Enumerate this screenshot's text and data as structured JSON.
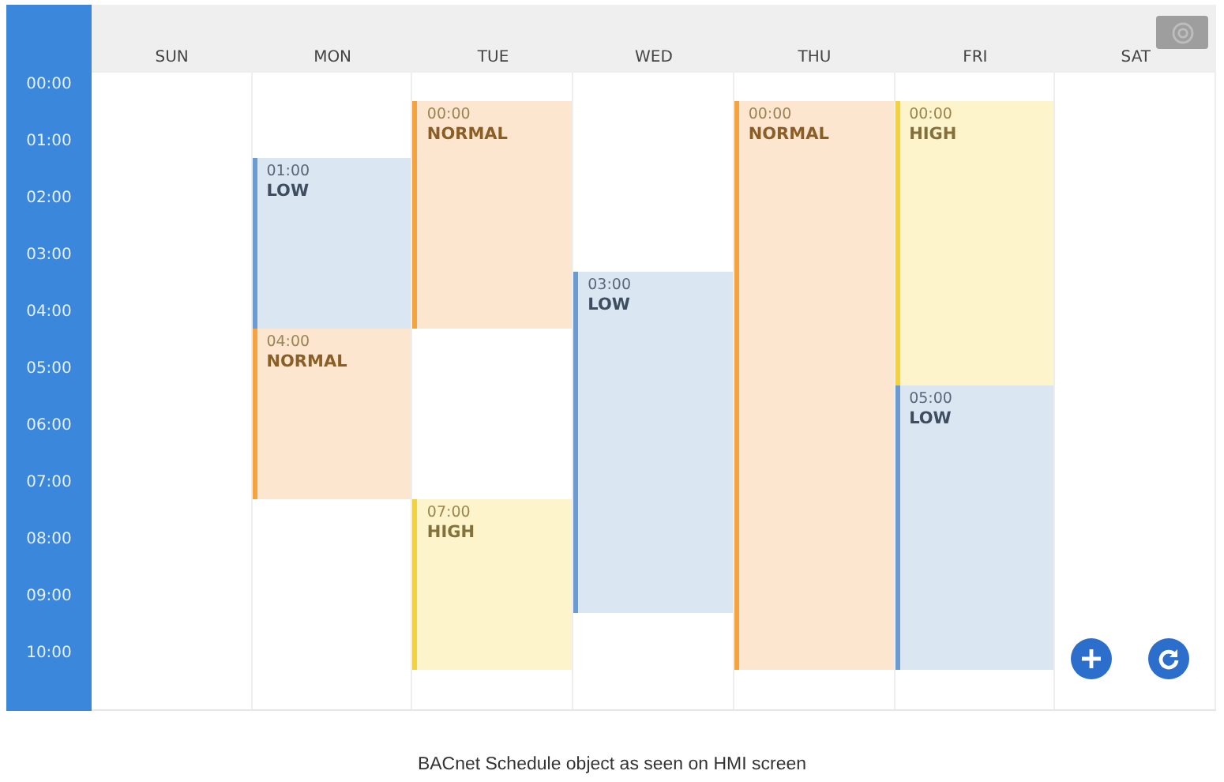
{
  "times": [
    "00:00",
    "01:00",
    "02:00",
    "03:00",
    "04:00",
    "05:00",
    "06:00",
    "07:00",
    "08:00",
    "09:00",
    "10:00"
  ],
  "days": [
    {
      "name": "SUN",
      "slots": [
        {
          "kind": "none"
        },
        {
          "kind": "none"
        },
        {
          "kind": "none"
        },
        {
          "kind": "none"
        },
        {
          "kind": "none"
        },
        {
          "kind": "none"
        },
        {
          "kind": "none"
        },
        {
          "kind": "none"
        },
        {
          "kind": "none"
        },
        {
          "kind": "none"
        }
      ]
    },
    {
      "name": "MON",
      "slots": [
        {
          "kind": "none"
        },
        {
          "kind": "low",
          "time": "01:00",
          "label": "LOW"
        },
        {
          "kind": "low"
        },
        {
          "kind": "low"
        },
        {
          "kind": "normal",
          "time": "04:00",
          "label": "NORMAL"
        },
        {
          "kind": "normal"
        },
        {
          "kind": "normal"
        },
        {
          "kind": "none"
        },
        {
          "kind": "none"
        },
        {
          "kind": "none"
        }
      ]
    },
    {
      "name": "TUE",
      "slots": [
        {
          "kind": "normal",
          "time": "00:00",
          "label": "NORMAL"
        },
        {
          "kind": "normal"
        },
        {
          "kind": "normal"
        },
        {
          "kind": "normal"
        },
        {
          "kind": "none"
        },
        {
          "kind": "none"
        },
        {
          "kind": "none"
        },
        {
          "kind": "high",
          "time": "07:00",
          "label": "HIGH"
        },
        {
          "kind": "high"
        },
        {
          "kind": "high"
        }
      ]
    },
    {
      "name": "WED",
      "slots": [
        {
          "kind": "none"
        },
        {
          "kind": "none"
        },
        {
          "kind": "none"
        },
        {
          "kind": "low",
          "time": "03:00",
          "label": "LOW"
        },
        {
          "kind": "low"
        },
        {
          "kind": "low"
        },
        {
          "kind": "low"
        },
        {
          "kind": "low"
        },
        {
          "kind": "low"
        },
        {
          "kind": "none"
        }
      ]
    },
    {
      "name": "THU",
      "slots": [
        {
          "kind": "normal",
          "time": "00:00",
          "label": "NORMAL"
        },
        {
          "kind": "normal"
        },
        {
          "kind": "normal"
        },
        {
          "kind": "normal"
        },
        {
          "kind": "normal"
        },
        {
          "kind": "normal"
        },
        {
          "kind": "normal"
        },
        {
          "kind": "normal"
        },
        {
          "kind": "normal"
        },
        {
          "kind": "normal"
        }
      ]
    },
    {
      "name": "FRI",
      "slots": [
        {
          "kind": "high",
          "time": "00:00",
          "label": "HIGH"
        },
        {
          "kind": "high"
        },
        {
          "kind": "high"
        },
        {
          "kind": "high"
        },
        {
          "kind": "high"
        },
        {
          "kind": "low",
          "time": "05:00",
          "label": "LOW"
        },
        {
          "kind": "low"
        },
        {
          "kind": "low"
        },
        {
          "kind": "low"
        },
        {
          "kind": "low"
        }
      ]
    },
    {
      "name": "SAT",
      "slots": [
        {
          "kind": "none"
        },
        {
          "kind": "none"
        },
        {
          "kind": "none"
        },
        {
          "kind": "none"
        },
        {
          "kind": "none"
        },
        {
          "kind": "none"
        },
        {
          "kind": "none"
        },
        {
          "kind": "none"
        },
        {
          "kind": "none"
        },
        {
          "kind": "none"
        }
      ]
    }
  ],
  "caption": "BACnet Schedule object as seen on HMI screen"
}
